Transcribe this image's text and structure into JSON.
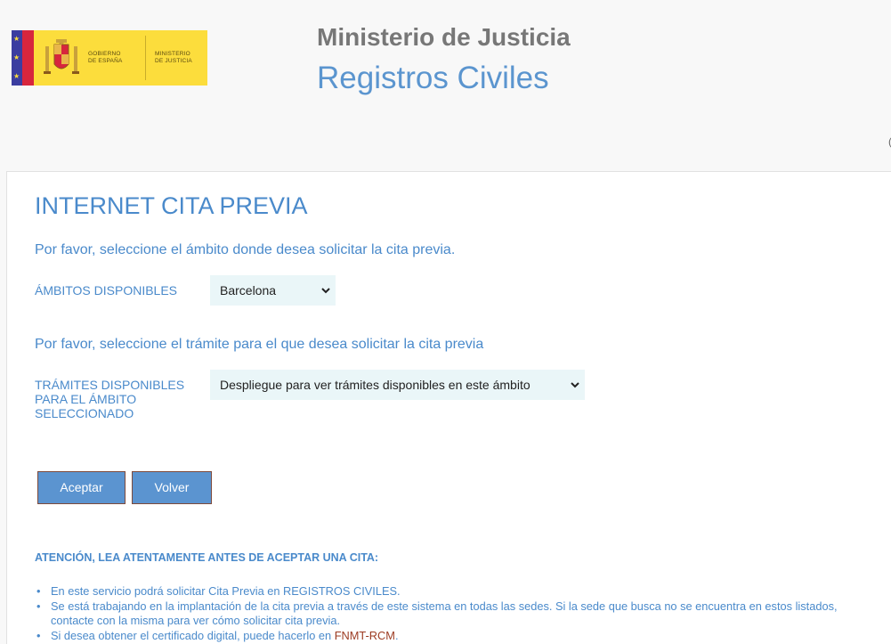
{
  "header": {
    "logo": {
      "gobierno_line1": "GOBIERNO",
      "gobierno_line2": "DE ESPAÑA",
      "ministerio_line1": "MINISTERIO",
      "ministerio_line2": "DE JUSTICIA"
    },
    "ministry_title": "Ministerio de Justicia",
    "site_title": "Registros Civiles"
  },
  "main": {
    "title": "INTERNET CITA PREVIA",
    "ambito_prompt": "Por favor, seleccione el ámbito donde desea solicitar la cita previa.",
    "ambito_label": "ÁMBITOS DISPONIBLES",
    "ambito_selected": "Barcelona",
    "tramite_prompt": "Por favor, seleccione el trámite para el que desea solicitar la cita previa",
    "tramite_label": "TRÁMITES DISPONIBLES PARA EL ÁMBITO SELECCIONADO",
    "tramite_selected": "Despliegue para ver trámites disponibles en este ámbito",
    "accept_label": "Aceptar",
    "back_label": "Volver",
    "attention": "ATENCIÓN, LEA ATENTAMENTE ANTES DE ACEPTAR UNA CITA:",
    "notes": [
      "En este servicio podrá solicitar Cita Previa en REGISTROS CIVILES.",
      "Se está trabajando en la implantación de la cita previa a través de este sistema en todas las sedes. Si la sede que busca no se encuentra en estos listados, contacte con la misma para ver cómo solicitar cita previa."
    ],
    "note3_prefix": "Si desea obtener el certificado digital, puede hacerlo en ",
    "note3_link": "FNMT-RCM",
    "note3_suffix": "."
  },
  "colors": {
    "accent": "#4a8acb",
    "button": "#5b94d0",
    "link": "#9c3b22",
    "select_bg": "#eaf6f8"
  }
}
